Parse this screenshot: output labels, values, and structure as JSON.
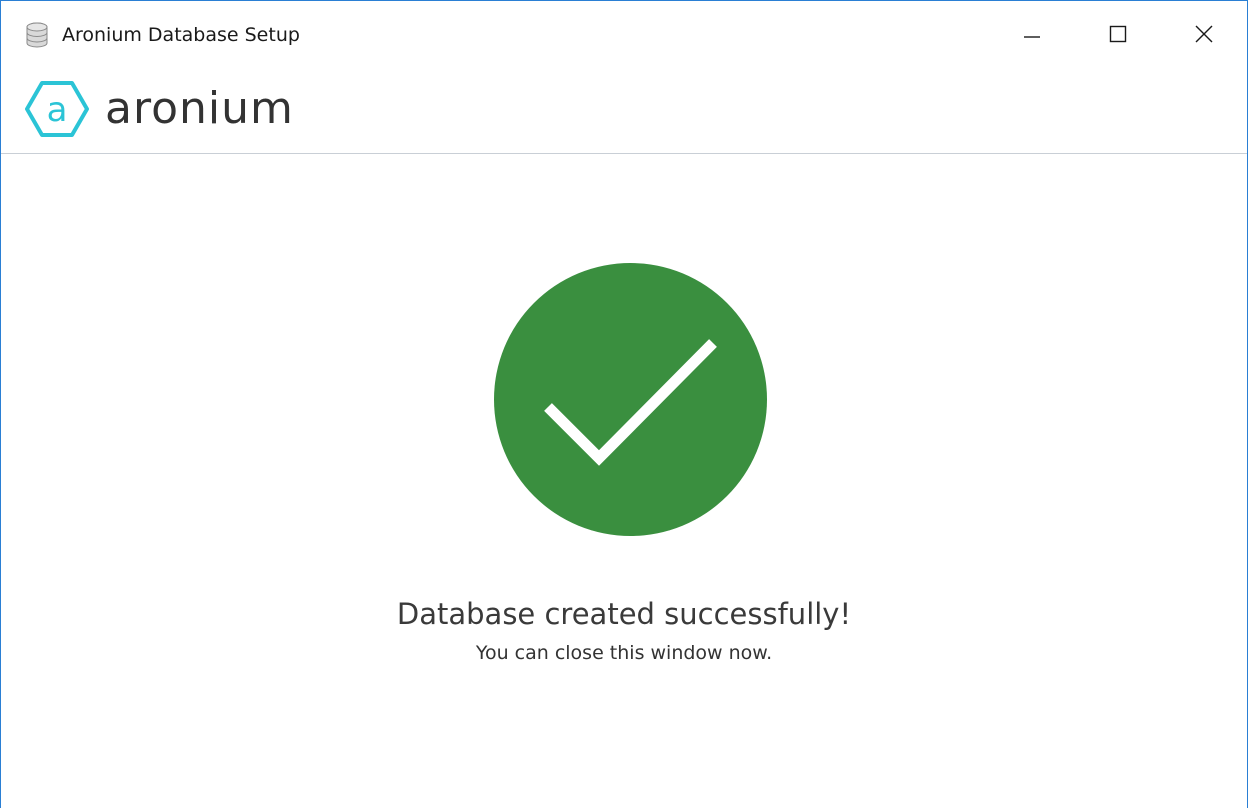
{
  "window": {
    "title": "Aronium Database Setup",
    "title_icon": "database-icon",
    "controls": {
      "minimize_icon": "minimize-icon",
      "maximize_icon": "maximize-icon",
      "close_icon": "close-icon"
    }
  },
  "brand": {
    "logo_icon": "aronium-hexagon-logo",
    "logo_letter": "a",
    "name": "aronium",
    "logo_color": "#2bc4d6"
  },
  "status": {
    "icon": "checkmark-circle-icon",
    "circle_color": "#3a8f3f",
    "message": "Database created successfully!",
    "submessage": "You can close this window now."
  }
}
